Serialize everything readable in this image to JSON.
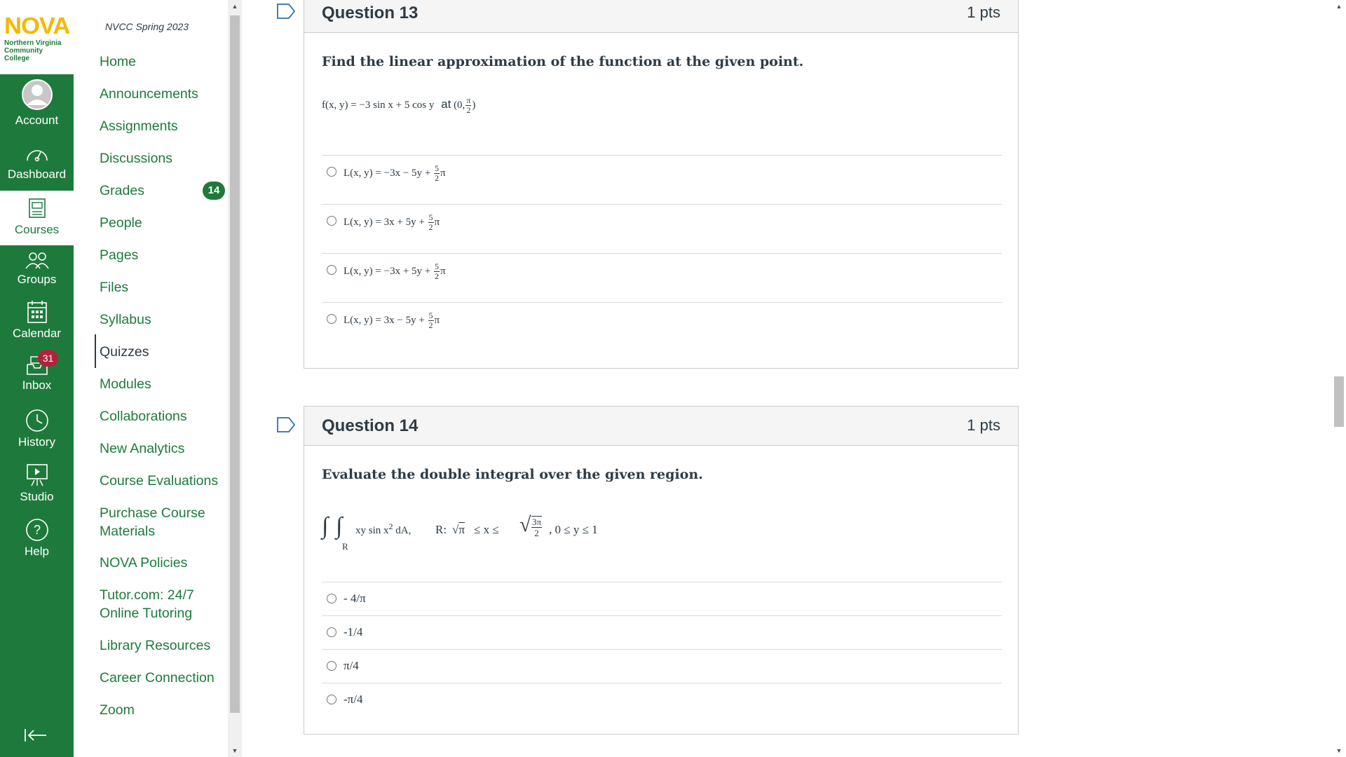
{
  "logo": {
    "title": "NOVA",
    "line1": "Northern Virginia",
    "line2": "Community College"
  },
  "global_nav": [
    {
      "id": "account",
      "label": "Account",
      "icon": "account-icon"
    },
    {
      "id": "dashboard",
      "label": "Dashboard",
      "icon": "dashboard-icon"
    },
    {
      "id": "courses",
      "label": "Courses",
      "icon": "courses-icon"
    },
    {
      "id": "groups",
      "label": "Groups",
      "icon": "groups-icon"
    },
    {
      "id": "calendar",
      "label": "Calendar",
      "icon": "calendar-icon"
    },
    {
      "id": "inbox",
      "label": "Inbox",
      "icon": "inbox-icon",
      "badge": "31"
    },
    {
      "id": "history",
      "label": "History",
      "icon": "history-icon"
    },
    {
      "id": "studio",
      "label": "Studio",
      "icon": "studio-icon"
    },
    {
      "id": "help",
      "label": "Help",
      "icon": "help-icon"
    }
  ],
  "course_nav": {
    "term": "NVCC Spring 2023",
    "items": [
      {
        "label": "Home"
      },
      {
        "label": "Announcements"
      },
      {
        "label": "Assignments"
      },
      {
        "label": "Discussions"
      },
      {
        "label": "Grades",
        "badge": "14"
      },
      {
        "label": "People"
      },
      {
        "label": "Pages"
      },
      {
        "label": "Files"
      },
      {
        "label": "Syllabus"
      },
      {
        "label": "Quizzes",
        "active": true
      },
      {
        "label": "Modules"
      },
      {
        "label": "Collaborations"
      },
      {
        "label": "New Analytics"
      },
      {
        "label": "Course Evaluations"
      },
      {
        "label": "Purchase Course Materials",
        "line1": "Purchase Course",
        "line2": "Materials"
      },
      {
        "label": "NOVA Policies"
      },
      {
        "label": "Tutor.com: 24/7 Online Tutoring",
        "line1": "Tutor.com: 24/7",
        "line2": "Online Tutoring"
      },
      {
        "label": "Library Resources"
      },
      {
        "label": "Career Connection"
      },
      {
        "label": "Zoom"
      }
    ]
  },
  "colors": {
    "brand_green": "#1e7a3c",
    "logo_gold": "#f5b800",
    "badge_red": "#b0223c",
    "text": "#2d3b45"
  },
  "questions": [
    {
      "title": "Question 13",
      "points": "1 pts",
      "prompt": "Find the linear approximation of the function at the given point.",
      "function": "f(x, y) = −3 sin x + 5 cos y",
      "at": "at",
      "point_prefix": "(0,",
      "point_num": "π",
      "point_den": "2",
      "point_suffix": ")",
      "answers": [
        {
          "text": "L(x, y) = −3x − 5y +",
          "num": "5",
          "den": "2",
          "suffix": "π"
        },
        {
          "text": "L(x, y) = 3x + 5y +",
          "num": "5",
          "den": "2",
          "suffix": "π"
        },
        {
          "text": "L(x, y) = −3x + 5y +",
          "num": "5",
          "den": "2",
          "suffix": "π"
        },
        {
          "text": "L(x, y) = 3x − 5y +",
          "num": "5",
          "den": "2",
          "suffix": "π"
        }
      ]
    },
    {
      "title": "Question 14",
      "points": "1 pts",
      "prompt": "Evaluate the double integral over the given region.",
      "integrand": "xy sin x",
      "sup": "2",
      "dA": "dA,",
      "region_label": "R",
      "region_prefix": "R:",
      "sqrt_pi": "π",
      "leq_x_leq": "≤ x ≤",
      "sqrt_num": "3π",
      "sqrt_den": "2",
      "y_range": ", 0 ≤ y ≤ 1",
      "answers": [
        {
          "text": "- 4/π"
        },
        {
          "text": "-1/4"
        },
        {
          "text": "π/4"
        },
        {
          "text": "-π/4"
        }
      ]
    }
  ]
}
